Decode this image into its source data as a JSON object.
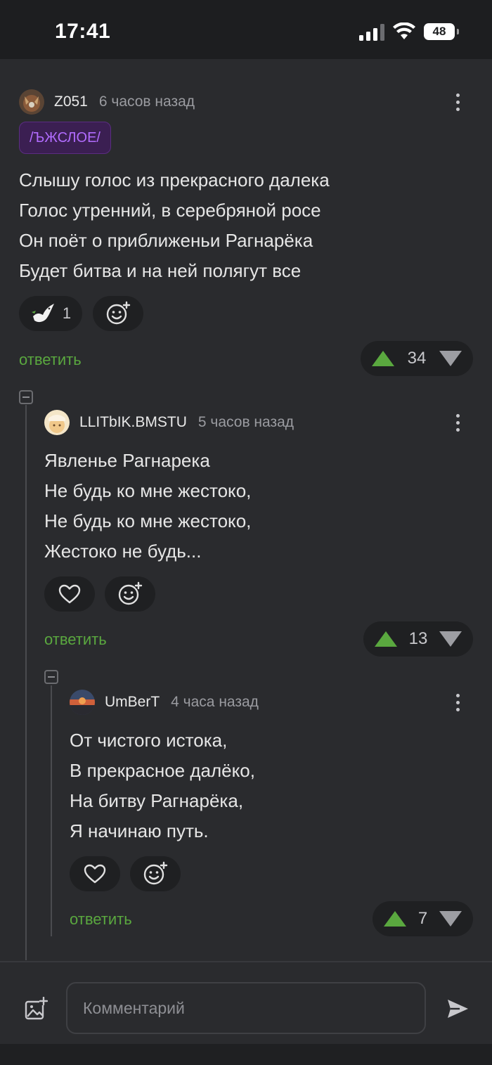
{
  "status": {
    "time": "17:41",
    "battery": "48"
  },
  "comments": [
    {
      "author": "Z051",
      "ago": "6 часов назад",
      "tag": "/ЪЖСЛОЕ/",
      "lines": [
        "Слышу голос из прекрасного далека",
        "Голос утренний, в серебряной росе",
        "Он поёт о приближеньи Рагнарёка",
        "Будет битва и на ней полягут все"
      ],
      "reaction_count": "1",
      "reply_label": "ответить",
      "score": "34"
    },
    {
      "author": "LLITbIK.BMSTU",
      "ago": "5 часов назад",
      "lines": [
        "Явленье Рагнарека",
        "Не будь ко мне жестоко,",
        "Не будь ко мне жестоко,",
        "Жестоко не будь..."
      ],
      "reply_label": "ответить",
      "score": "13"
    },
    {
      "author": "UmBerT",
      "ago": "4 часа назад",
      "lines": [
        "От чистого истока,",
        "В прекрасное далёко,",
        "На битву Рагнарёка,",
        "Я начинаю путь."
      ],
      "reply_label": "ответить",
      "score": "7"
    }
  ],
  "composer": {
    "placeholder": "Комментарий"
  },
  "colors": {
    "accent_green": "#5aa83f",
    "tag_purple": "#b26cff",
    "background": "#2a2b2e"
  }
}
